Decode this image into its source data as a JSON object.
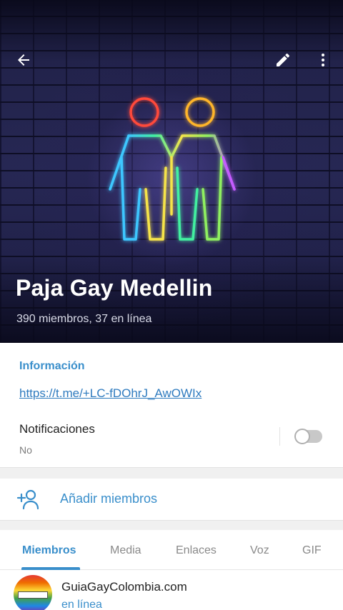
{
  "header": {
    "title": "Paja Gay Medellin",
    "subtitle": "390 miembros, 37 en línea",
    "icons": {
      "back": "arrow-back-icon",
      "edit": "pencil-icon",
      "more": "more-vert-icon"
    }
  },
  "info": {
    "label": "Información",
    "link": "https://t.me/+LC-fDOhrJ_AwOWIx",
    "notifications_title": "Notificaciones",
    "notifications_value": "No",
    "notifications_enabled": false
  },
  "add_members": {
    "label": "Añadir miembros",
    "icon": "add-person-icon"
  },
  "tabs": [
    {
      "label": "Miembros",
      "active": true
    },
    {
      "label": "Media",
      "active": false
    },
    {
      "label": "Enlaces",
      "active": false
    },
    {
      "label": "Voz",
      "active": false
    },
    {
      "label": "GIF",
      "active": false
    }
  ],
  "members": [
    {
      "name": "GuiaGayColombia.com",
      "status": "en línea"
    }
  ],
  "colors": {
    "accent": "#3a8fcb",
    "header_bg": "#1b1c3e"
  }
}
